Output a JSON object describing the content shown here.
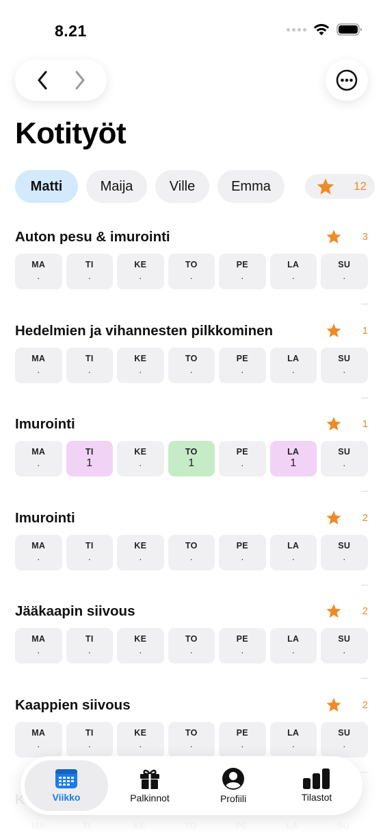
{
  "status": {
    "time": "8.21"
  },
  "title": "Kotityöt",
  "people": [
    {
      "name": "Matti",
      "active": true
    },
    {
      "name": "Maija",
      "active": false
    },
    {
      "name": "Ville",
      "active": false
    },
    {
      "name": "Emma",
      "active": false
    }
  ],
  "total_stars": "12",
  "day_labels": [
    "MA",
    "TI",
    "KE",
    "TO",
    "PE",
    "LA",
    "SU"
  ],
  "chores": [
    {
      "title": "Auton pesu & imurointi",
      "points": "3",
      "days": [
        ".",
        ".",
        ".",
        ".",
        ".",
        ".",
        "."
      ],
      "colors": [
        "",
        "",
        "",
        "",
        "",
        "",
        ""
      ]
    },
    {
      "title": "Hedelmien ja vihannesten pilkkominen",
      "points": "1",
      "days": [
        ".",
        ".",
        ".",
        ".",
        ".",
        ".",
        "."
      ],
      "colors": [
        "",
        "",
        "",
        "",
        "",
        "",
        ""
      ]
    },
    {
      "title": "Imurointi",
      "points": "1",
      "days": [
        ".",
        "1",
        ".",
        "1",
        ".",
        "1",
        "."
      ],
      "colors": [
        "",
        "pink",
        "",
        "green",
        "",
        "pink",
        ""
      ]
    },
    {
      "title": "Imurointi",
      "points": "2",
      "days": [
        ".",
        ".",
        ".",
        ".",
        ".",
        ".",
        "."
      ],
      "colors": [
        "",
        "",
        "",
        "",
        "",
        "",
        ""
      ]
    },
    {
      "title": "Jääkaapin siivous",
      "points": "2",
      "days": [
        ".",
        ".",
        ".",
        ".",
        ".",
        ".",
        "."
      ],
      "colors": [
        "",
        "",
        "",
        "",
        "",
        "",
        ""
      ]
    },
    {
      "title": "Kaappien siivous",
      "points": "2",
      "days": [
        ".",
        ".",
        ".",
        ".",
        ".",
        ".",
        "."
      ],
      "colors": [
        "",
        "",
        "",
        "",
        "",
        "",
        ""
      ]
    }
  ],
  "partial_chore": {
    "title_start": "K",
    "points": "2"
  },
  "tabs": [
    {
      "label": "Viikko",
      "icon": "calendar-icon",
      "active": true
    },
    {
      "label": "Palkinnot",
      "icon": "gift-icon",
      "active": false
    },
    {
      "label": "Profiili",
      "icon": "person-circle-icon",
      "active": false
    },
    {
      "label": "Tilastot",
      "icon": "bar-chart-icon",
      "active": false
    }
  ],
  "colors": {
    "accent": "#1a7ce8",
    "star": "#f08a24",
    "selected_chip": "#d3e9fc",
    "pink_day": "#f1d3f5",
    "green_day": "#c6ebc7"
  }
}
